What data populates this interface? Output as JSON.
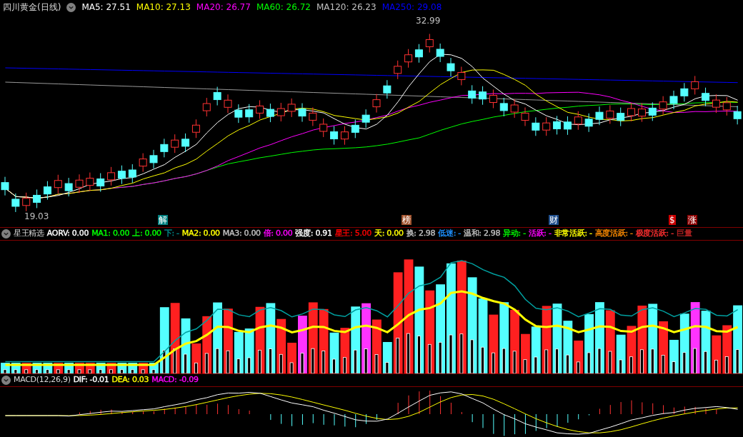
{
  "main_header": {
    "title": "四川黄金(日线)",
    "indicators": [
      {
        "label": "MA5: 27.51",
        "color": "#ffffff"
      },
      {
        "label": "MA10: 27.13",
        "color": "#ffff00"
      },
      {
        "label": "MA20: 26.77",
        "color": "#ff00ff"
      },
      {
        "label": "MA60: 26.72",
        "color": "#00ff00"
      },
      {
        "label": "MA120: 26.23",
        "color": "#c0c0c0"
      },
      {
        "label": "MA250: 29.08",
        "color": "#0000ff"
      }
    ]
  },
  "price_labels": {
    "high": "32.99",
    "low": "19.03"
  },
  "markers": [
    {
      "text": "解",
      "color": "#008080"
    },
    {
      "text": "榜",
      "color": "#a0522d"
    },
    {
      "text": "财",
      "color": "#1f4e8c"
    },
    {
      "text": "$",
      "color": "#cc0000"
    },
    {
      "text": "涨",
      "color": "#8b0000"
    }
  ],
  "volume_header": {
    "title": "星王精选",
    "indicators": [
      {
        "label": "AORV: 0.00",
        "color": "#ffffff"
      },
      {
        "label": "MA1: 0.00",
        "color": "#00ff00"
      },
      {
        "label": "上: 0.00",
        "color": "#00ff00"
      },
      {
        "label": "下: -",
        "color": "#008b8b"
      },
      {
        "label": "MA2: 0.00",
        "color": "#ffff00"
      },
      {
        "label": "MA3: 0.00",
        "color": "#c0c0c0"
      },
      {
        "label": "倍: 0.00",
        "color": "#ff00ff"
      },
      {
        "label": "强度: 0.91",
        "color": "#ffffff"
      },
      {
        "label": "星王: 5.00",
        "color": "#ff0000"
      },
      {
        "label": "天: 0.00",
        "color": "#ffff00"
      },
      {
        "label": "换: 2.98",
        "color": "#c0c0c0"
      },
      {
        "label": "低迷: -",
        "color": "#1e90ff"
      },
      {
        "label": "温和: 2.98",
        "color": "#c0c0c0"
      },
      {
        "label": "异动: -",
        "color": "#00ff00"
      },
      {
        "label": "活跃: -",
        "color": "#ff00ff"
      },
      {
        "label": "非常活跃: -",
        "color": "#ffff00"
      },
      {
        "label": "高度活跃: -",
        "color": "#ff8c00"
      },
      {
        "label": "极度活跃: -",
        "color": "#ff3030"
      },
      {
        "label": "巨量",
        "color": "#b22222"
      }
    ]
  },
  "macd_header": {
    "title": "MACD(12,26,9)",
    "indicators": [
      {
        "label": "DIF: -0.01",
        "color": "#ffffff"
      },
      {
        "label": "DEA: 0.03",
        "color": "#ffff00"
      },
      {
        "label": "MACD: -0.09",
        "color": "#ff00ff"
      }
    ]
  }
}
